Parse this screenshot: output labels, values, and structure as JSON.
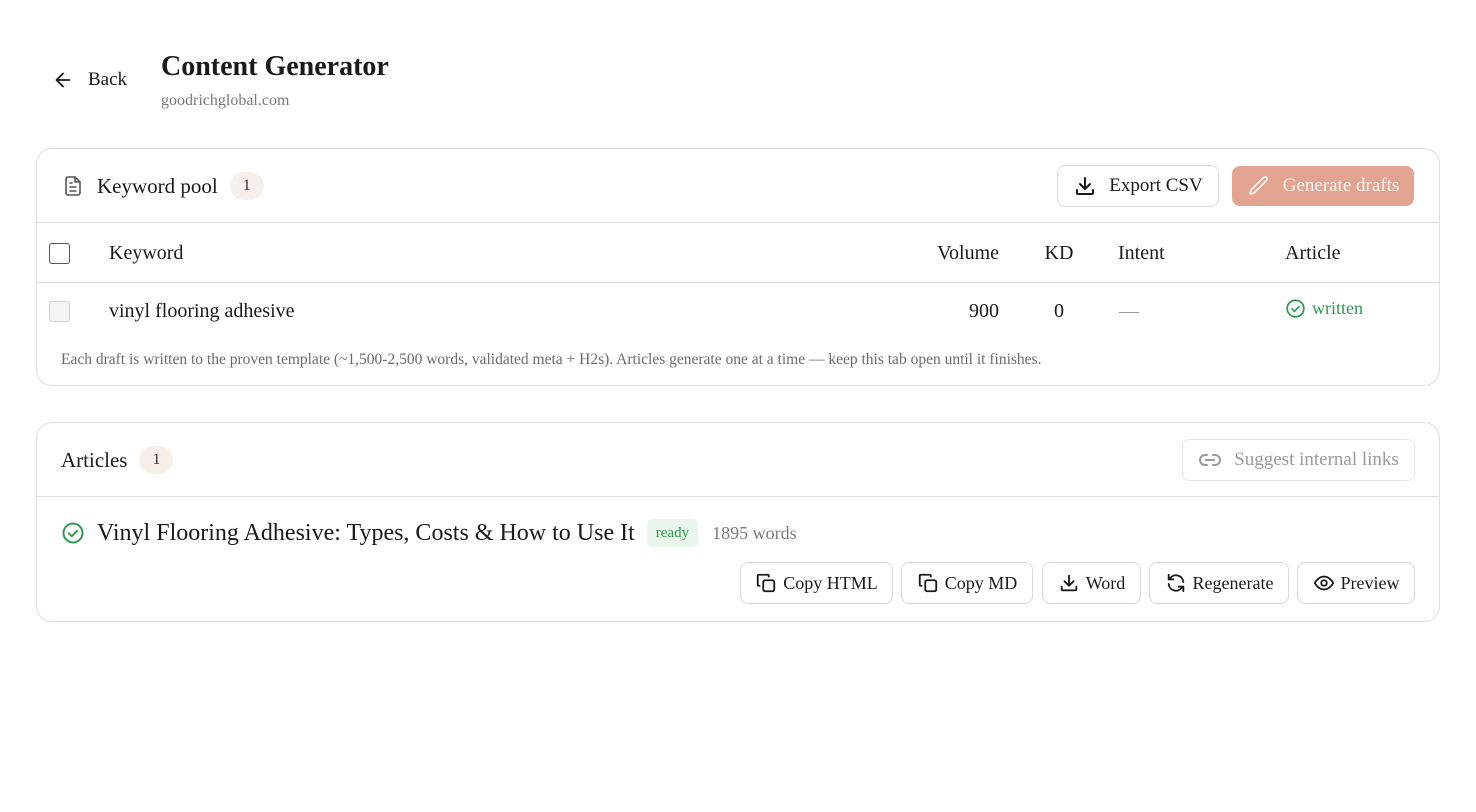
{
  "header": {
    "back_label": "Back",
    "title": "Content Generator",
    "subtitle": "goodrichglobal.com"
  },
  "keyword_pool": {
    "label": "Keyword pool",
    "count": "1",
    "export_label": "Export CSV",
    "generate_label": "Generate drafts",
    "columns": {
      "keyword": "Keyword",
      "volume": "Volume",
      "kd": "KD",
      "intent": "Intent",
      "article": "Article"
    },
    "rows": [
      {
        "keyword": "vinyl flooring adhesive",
        "volume": "900",
        "kd": "0",
        "intent": "—",
        "article_status": "written"
      }
    ],
    "note": "Each draft is written to the proven template (~1,500-2,500 words, validated meta + H2s). Articles generate one at a time — keep this tab open until it finishes."
  },
  "articles": {
    "label": "Articles",
    "count": "1",
    "suggest_label": "Suggest internal links",
    "items": [
      {
        "title": "Vinyl Flooring Adhesive: Types, Costs & How to Use It",
        "status": "ready",
        "word_count": "1895 words",
        "actions": {
          "copy_html": "Copy HTML",
          "copy_md": "Copy MD",
          "word": "Word",
          "regenerate": "Regenerate",
          "preview": "Preview"
        }
      }
    ]
  },
  "colors": {
    "accent": "#e2a491",
    "success": "#2e9a4f",
    "border": "#dedede",
    "muted_text": "#7a7a7a"
  },
  "icons": {
    "back": "arrow-left-icon",
    "keyword_pool": "document-icon",
    "export": "download-icon",
    "generate": "pencil-icon",
    "written": "check-circle-icon",
    "suggest": "link-icon",
    "ready": "check-circle-icon",
    "copy": "copy-icon",
    "word": "download-icon",
    "regenerate": "refresh-icon",
    "preview": "eye-icon"
  }
}
